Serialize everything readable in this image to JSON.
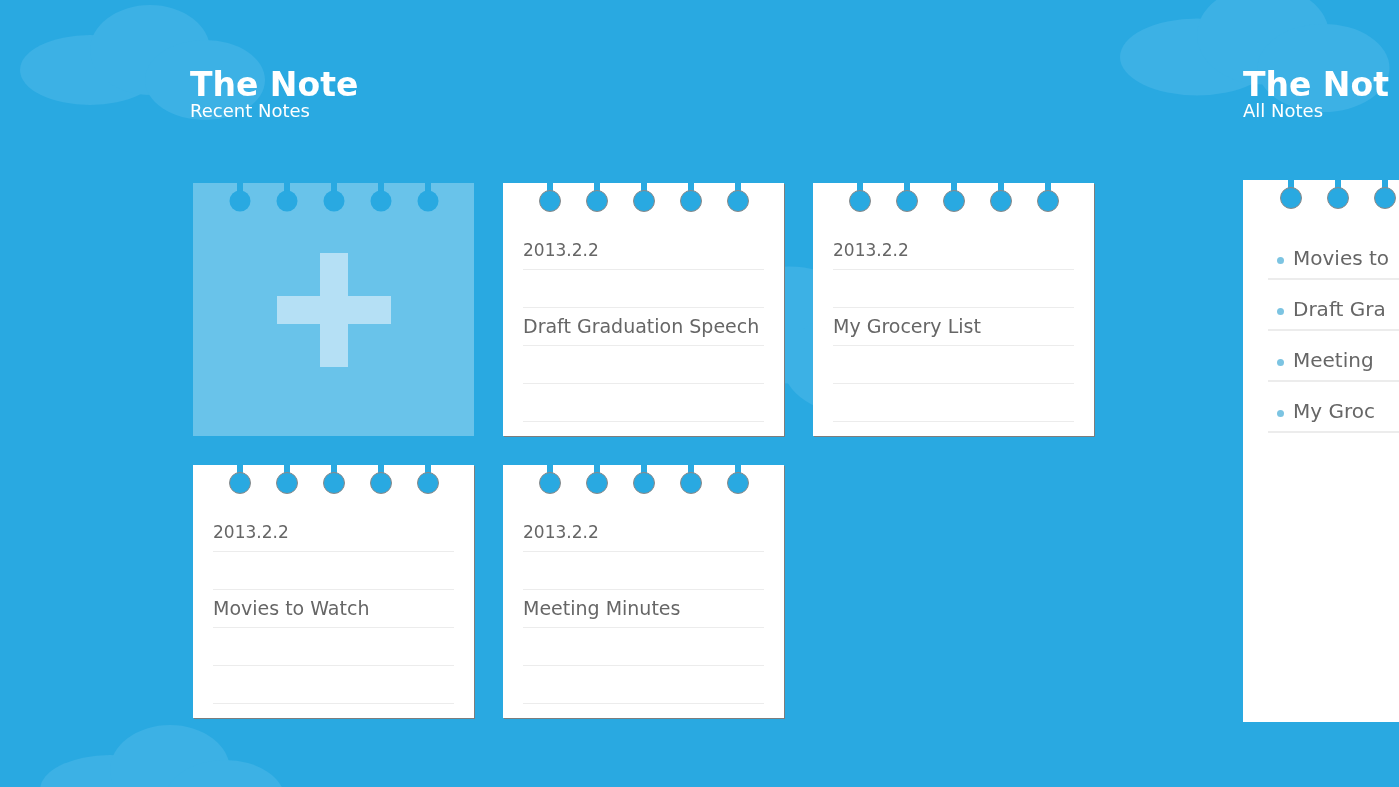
{
  "recent": {
    "title": "The Note",
    "subtitle": "Recent Notes",
    "tiles": [
      {
        "kind": "add"
      },
      {
        "kind": "note",
        "date": "2013.2.2",
        "title": "Draft Graduation Speech"
      },
      {
        "kind": "note",
        "date": "2013.2.2",
        "title": "My Grocery List"
      },
      {
        "kind": "note",
        "date": "2013.2.2",
        "title": "Movies to Watch"
      },
      {
        "kind": "note",
        "date": "2013.2.2",
        "title": "Meeting Minutes"
      }
    ]
  },
  "all": {
    "title": "The Not",
    "subtitle": "All Notes",
    "items": [
      "Movies to",
      "Draft Gra",
      "Meeting",
      "My Groc"
    ]
  }
}
